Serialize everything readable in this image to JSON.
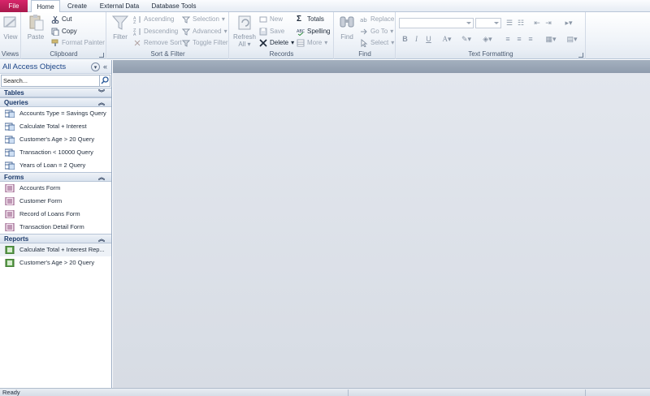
{
  "tabs": [
    "File",
    "Home",
    "Create",
    "External Data",
    "Database Tools"
  ],
  "ribbon": {
    "views": {
      "label": "Views",
      "view": "View"
    },
    "clipboard": {
      "label": "Clipboard",
      "paste": "Paste",
      "cut": "Cut",
      "copy": "Copy",
      "format_painter": "Format Painter"
    },
    "sort_filter": {
      "label": "Sort & Filter",
      "filter": "Filter",
      "ascending": "Ascending",
      "descending": "Descending",
      "remove_sort": "Remove Sort",
      "selection": "Selection",
      "advanced": "Advanced",
      "toggle_filter": "Toggle Filter"
    },
    "records": {
      "label": "Records",
      "refresh": "Refresh",
      "refresh_all": "All",
      "new": "New",
      "save": "Save",
      "delete": "Delete",
      "totals": "Totals",
      "spelling": "Spelling",
      "more": "More"
    },
    "find": {
      "label": "Find",
      "find": "Find",
      "replace": "Replace",
      "goto": "Go To",
      "select": "Select"
    },
    "text_formatting": {
      "label": "Text Formatting",
      "bold": "B",
      "italic": "I",
      "underline": "U",
      "font_color": "A"
    }
  },
  "nav": {
    "title": "All Access Objects",
    "search_placeholder": "Search...",
    "sections": [
      {
        "title": "Tables",
        "items": []
      },
      {
        "title": "Queries",
        "items": [
          "Accounts Type = Savings Query",
          "Calculate Total + Interest",
          "Customer's Age > 20 Query",
          "Transaction < 10000 Query",
          "Years of Loan = 2 Query"
        ]
      },
      {
        "title": "Forms",
        "items": [
          "Accounts Form",
          "Customer Form",
          "Record of Loans Form",
          "Transaction Detail Form"
        ]
      },
      {
        "title": "Reports",
        "items": [
          "Calculate Total + Interest Rep...",
          "Customer's Age > 20 Query"
        ]
      }
    ]
  },
  "status": {
    "text": "Ready"
  },
  "colors": {
    "file_tab": "#c0205a",
    "nav_title": "#1c4587",
    "workspace": "#dde1e8"
  }
}
